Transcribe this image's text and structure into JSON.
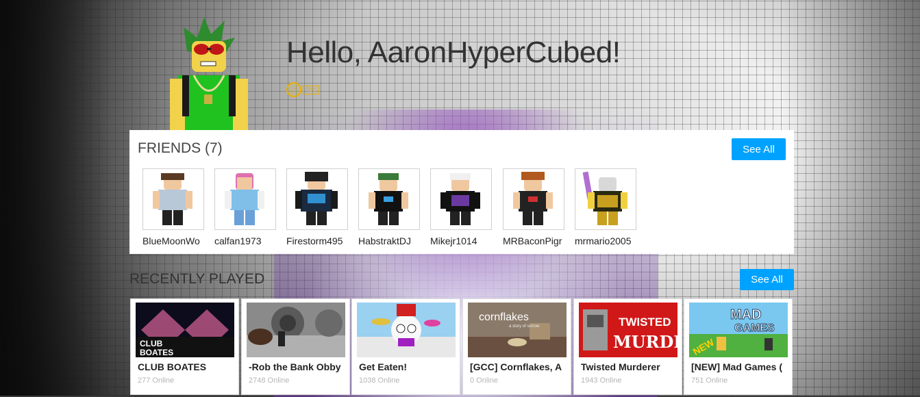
{
  "greeting": "Hello, AaronHyperCubed!",
  "badge_label": "TBC",
  "friends": {
    "title": "FRIENDS (7)",
    "see_all": "See All",
    "items": [
      {
        "name": "BlueMoonWo"
      },
      {
        "name": "calfan1973"
      },
      {
        "name": "Firestorm495"
      },
      {
        "name": "HabstraktDJ"
      },
      {
        "name": "Mikejr1014"
      },
      {
        "name": "MRBaconPigr"
      },
      {
        "name": "mrmario2005"
      }
    ]
  },
  "recently_played": {
    "title": "RECENTLY PLAYED",
    "see_all": "See All",
    "games": [
      {
        "name": "CLUB BOATES",
        "online": "277 Online",
        "thumb_text": "CLUB BOATES"
      },
      {
        "name": "-Rob the Bank Obby",
        "online": "2748 Online",
        "thumb_text": ""
      },
      {
        "name": "Get Eaten!",
        "online": "1038 Online",
        "thumb_text": ""
      },
      {
        "name": "[GCC] Cornflakes, A",
        "online": "0 Online",
        "thumb_text": "cornflakes"
      },
      {
        "name": "Twisted Murderer",
        "online": "1943 Online",
        "thumb_text": "TWISTED MURDER"
      },
      {
        "name": "[NEW] Mad Games (",
        "online": "751 Online",
        "thumb_text": "MAD GAMES"
      }
    ]
  },
  "colors": {
    "accent": "#00a2ff",
    "badge": "#e8b000"
  }
}
